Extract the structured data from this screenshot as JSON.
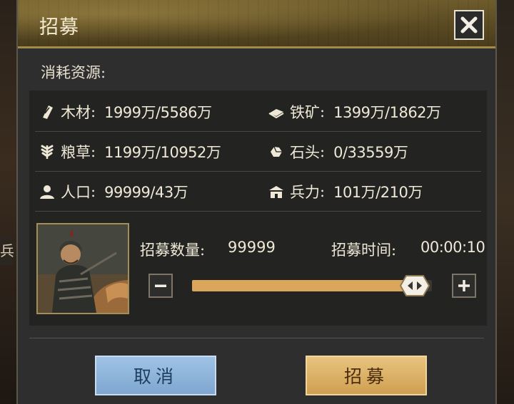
{
  "dialog": {
    "title": "招募",
    "close_icon": "close-icon",
    "section_label": "消耗资源:"
  },
  "resources": [
    {
      "icon": "wood-icon",
      "name": "木材",
      "value": "1999万/5586万"
    },
    {
      "icon": "iron-ore-icon",
      "name": "铁矿",
      "value": "1399万/1862万"
    },
    {
      "icon": "grain-icon",
      "name": "粮草",
      "value": "1199万/10952万"
    },
    {
      "icon": "stone-icon",
      "name": "石头",
      "value": "0/33559万"
    },
    {
      "icon": "population-icon",
      "name": "人口",
      "value": "99999/43万"
    },
    {
      "icon": "troops-icon",
      "name": "兵力",
      "value": "101万/210万"
    }
  ],
  "recruit": {
    "count_label": "招募数量:",
    "count_value": "99999",
    "time_label": "招募时间:",
    "time_value": "00:00:10",
    "slider_fraction": 0.93,
    "portrait": "soldier-portrait"
  },
  "buttons": {
    "cancel_label": "取消",
    "confirm_label": "招募"
  },
  "backdrop": {
    "left_fragment": "兵"
  },
  "colors": {
    "accent_gold": "#a28a49",
    "slider_fill": "#d9a65c",
    "cancel_button": "#8fb5dc",
    "confirm_button": "#dcb267"
  }
}
